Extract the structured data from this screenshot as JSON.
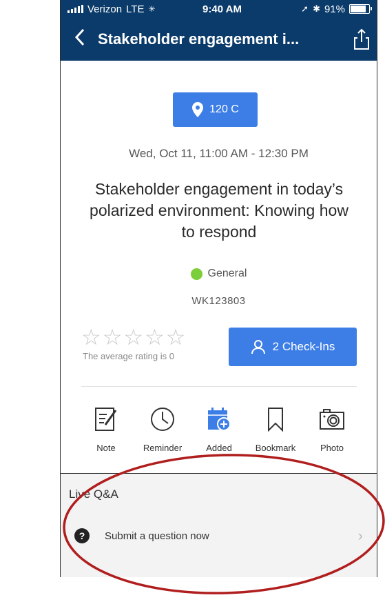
{
  "status_bar": {
    "carrier": "Verizon",
    "network": "LTE",
    "time": "9:40 AM",
    "battery": "91%",
    "battery_level": 0.91
  },
  "nav": {
    "title": "Stakeholder engagement i...",
    "back_icon": "chevron-left-icon",
    "share_icon": "share-icon"
  },
  "session": {
    "location": "120 C",
    "datetime": "Wed, Oct 11, 11:00 AM - 12:30 PM",
    "title": "Stakeholder engagement in today’s polarized environment: Knowing how to respond",
    "track": "General",
    "track_color": "#7cce3a",
    "code": "WK123803"
  },
  "rating": {
    "stars": 5,
    "value": 0,
    "text": "The average rating is 0"
  },
  "checkins": {
    "label": "2 Check-Ins"
  },
  "actions": [
    {
      "label": "Note"
    },
    {
      "label": "Reminder"
    },
    {
      "label": "Added"
    },
    {
      "label": "Bookmark"
    },
    {
      "label": "Photo"
    }
  ],
  "qa": {
    "title": "Live Q&A",
    "row_label": "Submit a question now"
  },
  "colors": {
    "nav_bg": "#0b3b6a",
    "accent": "#3d7ee6",
    "highlight": "#b01e1e"
  }
}
